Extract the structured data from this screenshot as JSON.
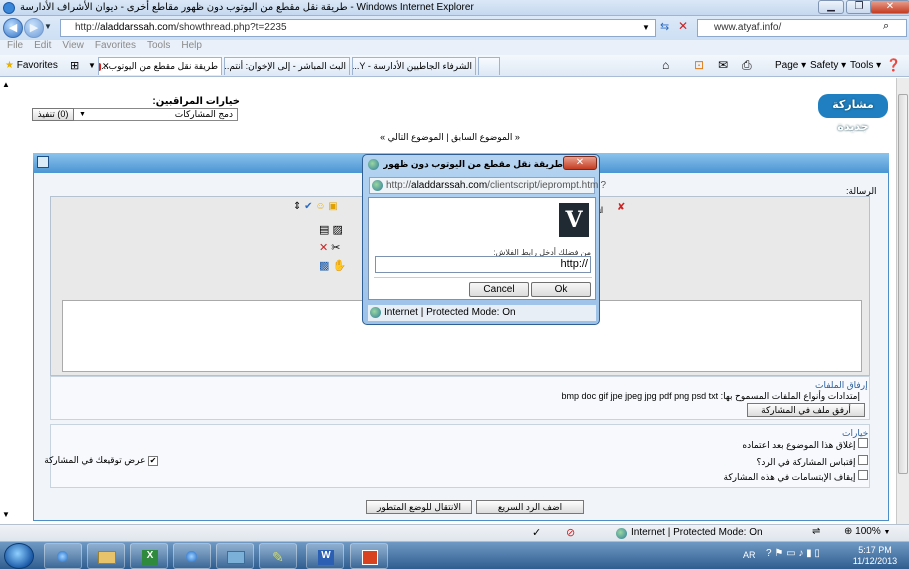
{
  "window": {
    "title": "طريقة نقل مقطع من اليوتوب دون ظهور مقاطع أخرى - ديوان الأشراف الأدارسة - Windows Internet Explorer",
    "minimize": "▁",
    "restore": "❐",
    "close": "✕"
  },
  "address": {
    "url_prefix": "http://",
    "url_host": "aladdarssah.com",
    "url_path": "/showthread.php?t=2235",
    "search_text": "www.atyaf.info/"
  },
  "menu": [
    "File",
    "Edit",
    "View",
    "Favorites",
    "Tools",
    "Help"
  ],
  "favorites": {
    "label": "Favorites",
    "tabs": [
      {
        "label": "طريقة نقل مقطع من اليوتوب...",
        "active": true,
        "close": "✕"
      },
      {
        "label": "البث المباشر - إلى الإخوان: أنتم..."
      },
      {
        "label": "الشرفاء الجاطيين الأدارسة - Y..."
      }
    ],
    "commands": [
      "Page ▾",
      "Safety ▾",
      "Tools ▾"
    ]
  },
  "page": {
    "moderator_options": "خيارات المراقبين:",
    "moderator_select": "دمج المشاركات",
    "execute_button": "(0) تنفيذ",
    "logo_text": "مشاركة جديدة",
    "thread_nav": "« الموضوع السابق | الموضوع التالي »",
    "message_label": "الرسالة:",
    "font_name": "rial",
    "attach_label": "إرفاق الملفات",
    "extensions_text": "إمتدادات وأنواع الملفات المسموح بها: bmp doc gif jpe jpeg jpg pdf png psd txt zip",
    "attach_button": "أرفق ملف في المشاركة",
    "options_label": "خيارات",
    "opt_close_thread": "إغلاق هذا الموضوع بعد اعتماده",
    "opt_quote_reply": "إقتباس المشاركة في الرد؟",
    "opt_disable_smilies": "إيقاف الإبتسامات في هذه المشاركة",
    "opt_show_signature": "عرض توقيعك في المشاركة",
    "quick_reply_button": "اضف الرد السريع",
    "advanced_mode_button": "الانتقال للوضع المتطور"
  },
  "dialog": {
    "title": "طريقة نقل مقطع من اليوتوب دون ظهور مقاطع أخرى - ديوان...",
    "url_prefix": "http://",
    "url_host": "aladdarssah.com",
    "url_path": "/clientscript/ieprompt.html?",
    "logo_letter": "V",
    "prompt_text": "من فضلك أدخل رابط الفلاش:",
    "input_value": "http://",
    "cancel": "Cancel",
    "ok": "Ok",
    "status": "Internet | Protected Mode: On"
  },
  "statusbar": {
    "zone": "Internet | Protected Mode: On",
    "zoom": "100%"
  },
  "taskbar": {
    "lang": "AR",
    "time": "5:17 PM",
    "date": "11/12/2013"
  },
  "colors": {
    "accent": "#4a95d3",
    "close_red": "#c43c22",
    "link_blue": "#2c5fa0"
  }
}
